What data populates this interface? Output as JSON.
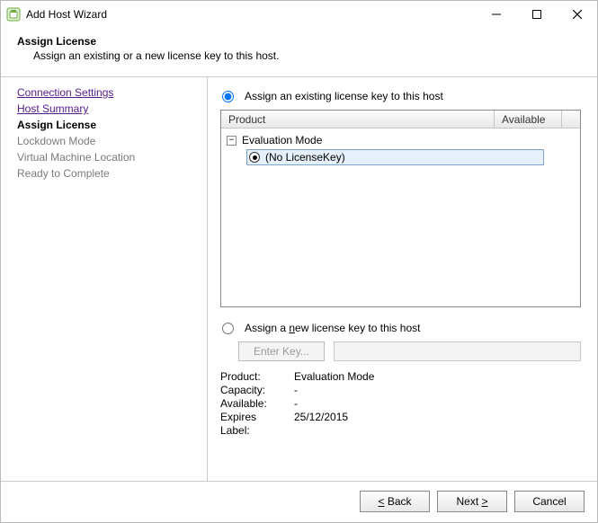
{
  "window": {
    "title": "Add Host Wizard"
  },
  "header": {
    "title": "Assign License",
    "subtitle": "Assign an existing or a new license key to this host."
  },
  "sidebar": {
    "steps": [
      {
        "label": "Connection Settings",
        "state": "link"
      },
      {
        "label": "Host Summary",
        "state": "link"
      },
      {
        "label": "Assign License",
        "state": "current"
      },
      {
        "label": "Lockdown Mode",
        "state": "future"
      },
      {
        "label": "Virtual Machine Location",
        "state": "future"
      },
      {
        "label": "Ready to Complete",
        "state": "future"
      }
    ]
  },
  "main": {
    "existing_radio_label": "Assign an existing license key to this host",
    "new_radio_label_prefix": "Assign a ",
    "new_radio_label_underline": "n",
    "new_radio_label_suffix": "ew license key to this host",
    "columns": {
      "product": "Product",
      "available": "Available"
    },
    "tree": {
      "group_label": "Evaluation Mode",
      "selected_label": "(No LicenseKey)"
    },
    "enter_key_btn": "Enter Key...",
    "info": {
      "product_label": "Product:",
      "capacity_label": "Capacity:",
      "available_label": "Available:",
      "expires_label": "Expires",
      "label_label": "Label:",
      "product_value": "Evaluation Mode",
      "capacity_value": "-",
      "available_value": "-",
      "expires_value": "25/12/2015",
      "label_value": ""
    }
  },
  "footer": {
    "back_u": "<",
    "back_text": " Back",
    "next_text": "Next ",
    "next_u": ">",
    "cancel": "Cancel"
  }
}
